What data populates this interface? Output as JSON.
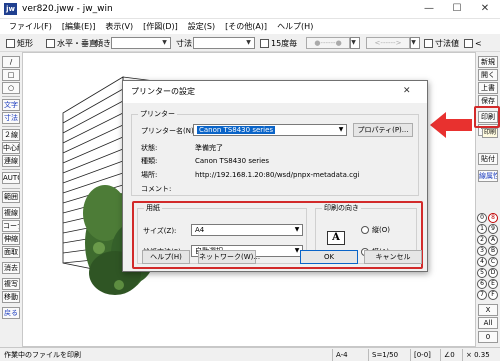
{
  "window": {
    "icon_text": "jw",
    "title": "ver820.jww - jw_win",
    "minimize_glyph": "—",
    "maximize_glyph": "☐",
    "close_glyph": "✕"
  },
  "menu": [
    "ファイル(F)",
    "[編集(E)]",
    "表示(V)",
    "[作図(D)]",
    "設定(S)",
    "[その他(A)]",
    "ヘルプ(H)"
  ],
  "toolbar": {
    "check_rect": "矩形",
    "check_hv": "水平・垂直",
    "angle_label": "傾き",
    "size_label": "寸法",
    "check_15deg": "15度毎",
    "btn_dot": "●------●",
    "btn_arrow": "<------>",
    "check_dim_value": "寸法値",
    "check_lt": "<"
  },
  "left_palette": {
    "shapes": [
      "/",
      "□",
      "○"
    ],
    "tools_a": [
      "文字",
      "寸法"
    ],
    "tools_b": [
      "２線",
      "中心線",
      "連線"
    ],
    "tools_c": [
      "AUTO"
    ],
    "tools_d": [
      "範囲",
      "複線",
      "コーナー",
      "伸縮",
      "面取",
      "消去",
      "複写",
      "移動"
    ],
    "undo": "戻る"
  },
  "right_palette": {
    "top": [
      "新規",
      "開く",
      "上書",
      "保存",
      "印刷",
      "切取"
    ],
    "paste": "貼付",
    "layer_label": "線属性",
    "circles": [
      "0",
      "8",
      "1",
      "9",
      "2",
      "A",
      "3",
      "B",
      "4",
      "C",
      "5",
      "D",
      "6",
      "E",
      "7",
      "F"
    ],
    "bottom": [
      "X",
      "All",
      "0"
    ]
  },
  "callout": {
    "print_label": "印刷"
  },
  "dialog": {
    "title": "プリンターの設定",
    "close_glyph": "✕",
    "printer_group": "プリンター",
    "printer_name_label": "プリンター名(N):",
    "printer_name_value": "Canon TS8430 series",
    "properties_button": "プロパティ(P)...",
    "status_label": "状態:",
    "status_value": "準備完了",
    "type_label": "種類:",
    "type_value": "Canon TS8430 series",
    "where_label": "場所:",
    "where_value": "http://192.168.1.20:80/wsd/pnpx-metadata.cgi",
    "comment_label": "コメント:",
    "paper_group": "用紙",
    "size_label": "サイズ(Z):",
    "size_value": "A4",
    "source_label": "給紙方法(S):",
    "source_value": "自動選択",
    "orientation_group": "印刷の向き",
    "portrait_label": "縦(O)",
    "landscape_label": "横(A)",
    "orientation_selected": "landscape",
    "orientation_icon_letter": "A",
    "help_button": "ヘルプ(H)",
    "network_button": "ネットワーク(W)...",
    "ok_button": "OK",
    "cancel_button": "キャンセル"
  },
  "statusbar": {
    "message": "作業中のファイルを印刷",
    "paper": "A-4",
    "scale": "S=1/50",
    "layer": "[0-0]",
    "angle": "∠0",
    "zoom": "× 0.35"
  },
  "colors": {
    "selection": "#0a64c8",
    "highlight": "#d22a2a",
    "tree": "#3e6b2e"
  }
}
